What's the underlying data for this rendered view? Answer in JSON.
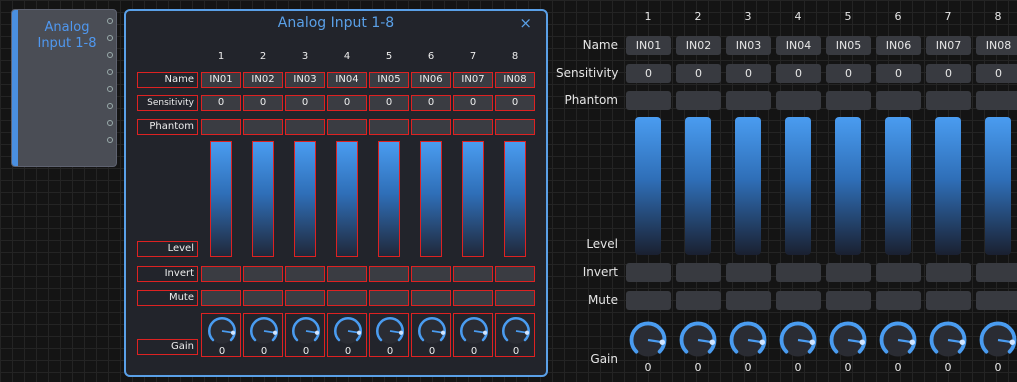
{
  "module": {
    "title": "Analog Input 1-8"
  },
  "panel": {
    "title": "Analog Input 1-8",
    "close_glyph": "×"
  },
  "labels": {
    "name": "Name",
    "sensitivity": "Sensitivity",
    "phantom": "Phantom",
    "level": "Level",
    "invert": "Invert",
    "mute": "Mute",
    "gain": "Gain"
  },
  "channels": [
    {
      "number": "1",
      "name": "IN01",
      "sensitivity": "0",
      "gain": "0",
      "level": 1.0
    },
    {
      "number": "2",
      "name": "IN02",
      "sensitivity": "0",
      "gain": "0",
      "level": 1.0
    },
    {
      "number": "3",
      "name": "IN03",
      "sensitivity": "0",
      "gain": "0",
      "level": 1.0
    },
    {
      "number": "4",
      "name": "IN04",
      "sensitivity": "0",
      "gain": "0",
      "level": 1.0
    },
    {
      "number": "5",
      "name": "IN05",
      "sensitivity": "0",
      "gain": "0",
      "level": 1.0
    },
    {
      "number": "6",
      "name": "IN06",
      "sensitivity": "0",
      "gain": "0",
      "level": 1.0
    },
    {
      "number": "7",
      "name": "IN07",
      "sensitivity": "0",
      "gain": "0",
      "level": 1.0
    },
    {
      "number": "8",
      "name": "IN08",
      "sensitivity": "0",
      "gain": "0",
      "level": 1.0
    }
  ],
  "colors": {
    "accent": "#5aa0e8",
    "overlay": "#dd2222",
    "bar_top": "#4a9cf0"
  },
  "icons": {
    "close": "close-icon",
    "knob": "gain-knob-icon",
    "port": "port-icon"
  }
}
